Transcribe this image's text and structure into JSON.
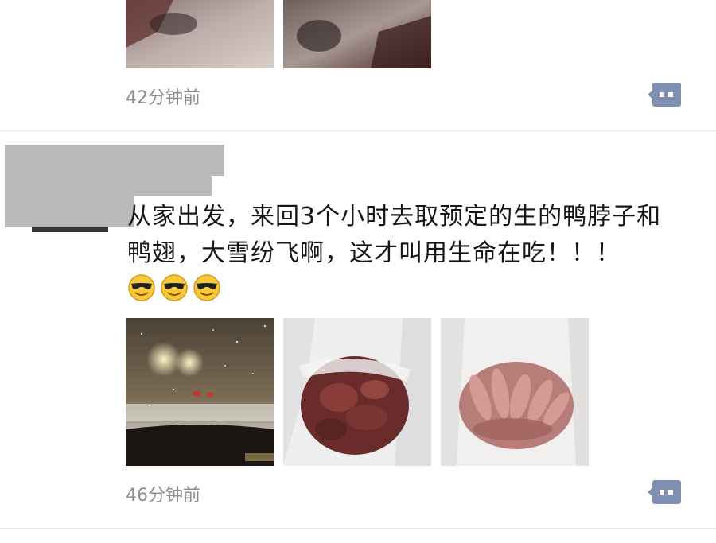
{
  "post1": {
    "timestamp": "42分钟前",
    "photos": [
      {
        "icon": "cropped-photo-dark"
      },
      {
        "icon": "cropped-photo-dark"
      }
    ]
  },
  "post2": {
    "text": "从家出发，来回3个小时去取预定的生的鸭脖子和鸭翅，大雪纷飞啊，这才叫用生命在吃！！！",
    "emojis": [
      "sunglasses-smile-emoji",
      "sunglasses-smile-emoji",
      "sunglasses-smile-emoji"
    ],
    "photos": [
      {
        "icon": "snowy-night-road-photo"
      },
      {
        "icon": "duck-necks-in-bag-photo"
      },
      {
        "icon": "duck-wings-in-bag-photo"
      }
    ],
    "timestamp": "46分钟前"
  },
  "colors": {
    "comment_button": "#7f8fb3",
    "timestamp": "#8d8d8d",
    "text": "#161616",
    "redaction": "#b9b9b9"
  }
}
